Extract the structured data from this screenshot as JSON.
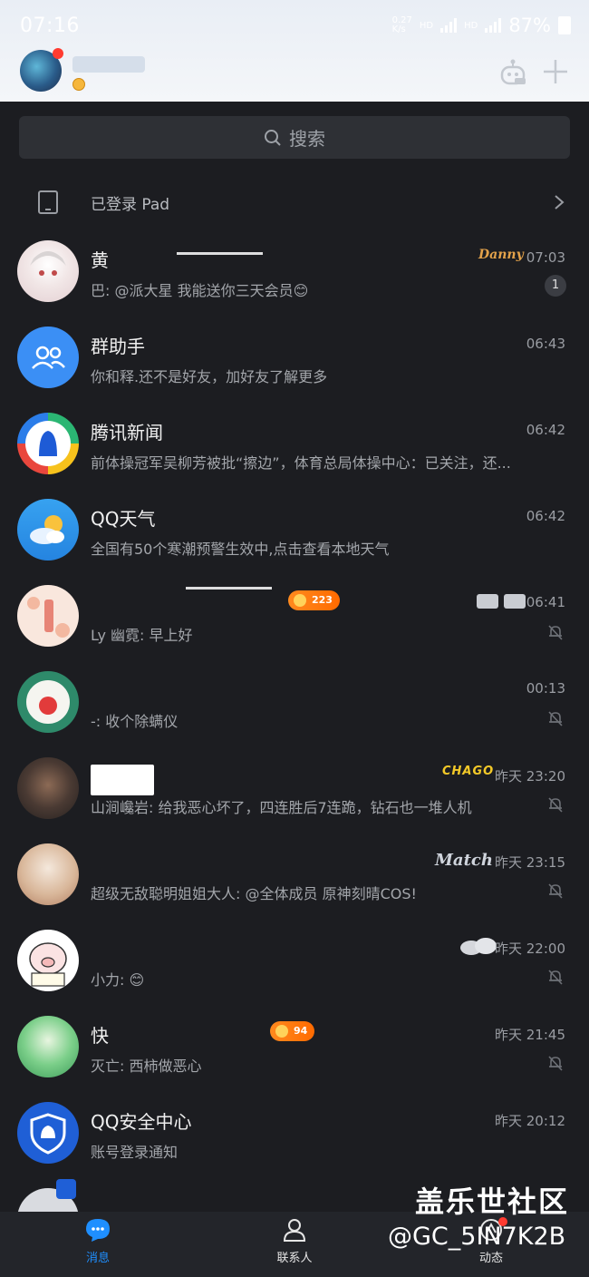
{
  "status_bar": {
    "time": "07:16",
    "network": "0.27\nK/s",
    "hd_1": "HD",
    "hd_2": "HD",
    "battery": "87%"
  },
  "search": {
    "label": "搜索"
  },
  "pad_row": {
    "label": "已登录 Pad"
  },
  "conversations": [
    {
      "name": "黄",
      "time": "07:03",
      "message": "  巴: @派大星 我能送你三天会员😊",
      "unread": "1",
      "brand_tag": "Danny"
    },
    {
      "name": "群助手",
      "time": "06:43",
      "message": "你和释.还不是好友，加好友了解更多"
    },
    {
      "name": "腾讯新闻",
      "time": "06:42",
      "message": "前体操冠军吴柳芳被批“擦边”，体育总局体操中心：已关注，还..."
    },
    {
      "name": "QQ天气",
      "time": "06:42",
      "message": "全国有50个寒潮预警生效中,点击查看本地天气"
    },
    {
      "name": "",
      "time": "06:41",
      "message": "Ly  幽霓: 早上好",
      "tag": "223"
    },
    {
      "name": "",
      "time": "00:13",
      "message": "-: 收个除螨仪"
    },
    {
      "name": "",
      "time": "昨天 23:20",
      "message": "山涧巉岩: 给我恶心坏了，四连胜后7连跪，钻石也一堆人机",
      "brand_tag": "CHAGO"
    },
    {
      "name": "",
      "time": "昨天 23:15",
      "message": "超级无敌聪明姐姐大人: @全体成员 原神刻晴COS!",
      "brand_tag": "Match"
    },
    {
      "name": "",
      "time": "昨天 22:00",
      "message": "小力: 😊"
    },
    {
      "name": "快",
      "time": "昨天 21:45",
      "message": "灭亡: 西柿做恶心",
      "tag": "94"
    },
    {
      "name": "QQ安全中心",
      "time": "昨天 20:12",
      "message": "账号登录通知"
    }
  ],
  "bottom_nav": [
    {
      "label": "消息",
      "icon": "message-icon",
      "active": true
    },
    {
      "label": "联系人",
      "icon": "contacts-icon",
      "active": false
    },
    {
      "label": "动态",
      "icon": "activity-icon",
      "active": false
    }
  ],
  "watermark": {
    "title": "盖乐世社区",
    "handle": "@GC_5IN7K2B"
  },
  "colors": {
    "accent": "#1f8fff",
    "background": "#1c1d21",
    "header": "#eef2f7"
  }
}
